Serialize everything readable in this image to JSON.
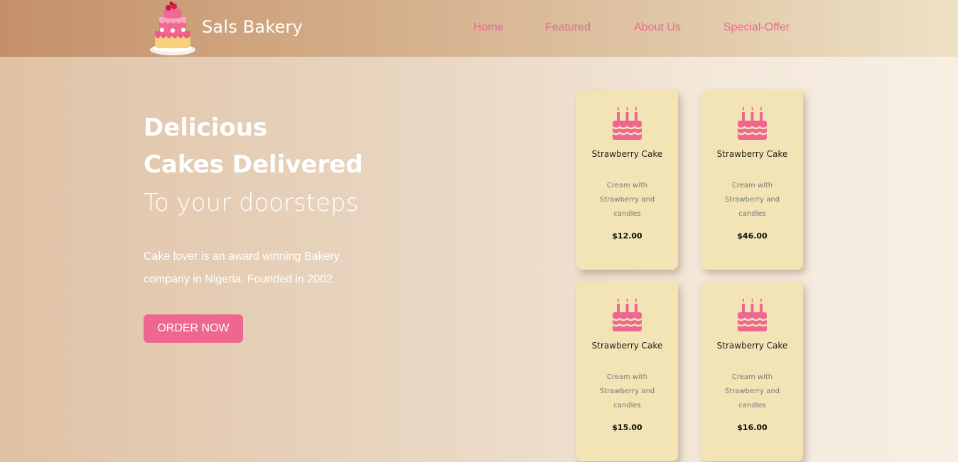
{
  "brand": {
    "name": "Sals Bakery",
    "logo_icon": "cake-logo-icon"
  },
  "nav": {
    "items": [
      "Home",
      "Featured",
      "About Us",
      "Special-Offer"
    ]
  },
  "hero": {
    "title_line1": "Delicious",
    "title_line2": "Cakes Delivered",
    "subtitle": "To your doorsteps",
    "description": "Cake lover is an award winning Bakery company in Nigeria. Founded in 2002",
    "cta_label": "ORDER NOW"
  },
  "products": [
    {
      "name": "Strawberry Cake",
      "description": "Cream with Strawberry and candles",
      "price": "$12.00",
      "icon": "birthday-cake-icon"
    },
    {
      "name": "Strawberry Cake",
      "description": "Cream with Strawberry and candles",
      "price": "$46.00",
      "icon": "birthday-cake-icon"
    },
    {
      "name": "Strawberry Cake",
      "description": "Cream with Strawberry and candles",
      "price": "$15.00",
      "icon": "birthday-cake-icon"
    },
    {
      "name": "Strawberry Cake",
      "description": "Cream with Strawberry and candles",
      "price": "$16.00",
      "icon": "birthday-cake-icon"
    }
  ],
  "colors": {
    "accent": "#ef6691",
    "card": "#f2e4b5",
    "nav_text": "#e9698f"
  }
}
